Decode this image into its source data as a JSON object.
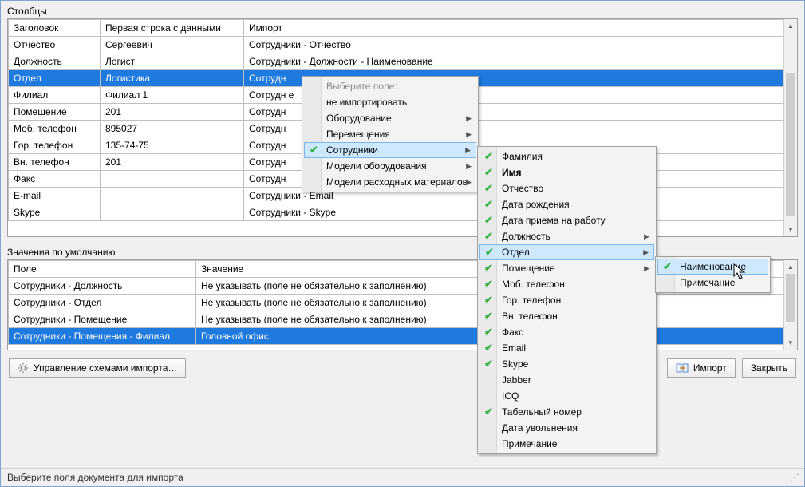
{
  "labels": {
    "columns_section": "Столбцы",
    "defaults_section": "Значения по умолчанию",
    "status": "Выберите поля документа для импорта"
  },
  "columns_table": {
    "headers": {
      "c0": "Заголовок",
      "c1": "Первая строка с данными",
      "c2": "Импорт"
    },
    "rows": [
      {
        "c0": "Отчество",
        "c1": "Сергеевич",
        "c2": "Сотрудники - Отчество"
      },
      {
        "c0": "Должность",
        "c1": "Логист",
        "c2": "Сотрудники - Должности - Наименование"
      },
      {
        "c0": "Отдел",
        "c1": "Логистика",
        "c2": "Сотрудн",
        "selected": true
      },
      {
        "c0": "Филиал",
        "c1": "Филиал 1",
        "c2": "Сотрудн                                                   е"
      },
      {
        "c0": "Помещение",
        "c1": "201",
        "c2": "Сотрудн"
      },
      {
        "c0": "Моб. телефон",
        "c1": "895027",
        "c2": "Сотрудн"
      },
      {
        "c0": "Гор. телефон",
        "c1": "135-74-75",
        "c2": "Сотрудн"
      },
      {
        "c0": "Вн. телефон",
        "c1": "201",
        "c2": "Сотрудн"
      },
      {
        "c0": "Факс",
        "c1": "",
        "c2": "Сотрудн"
      },
      {
        "c0": "E-mail",
        "c1": "",
        "c2": "Сотрудники - Email"
      },
      {
        "c0": "Skype",
        "c1": "",
        "c2": "Сотрудники - Skype"
      }
    ]
  },
  "defaults_table": {
    "headers": {
      "c0": "Поле",
      "c1": "Значение"
    },
    "rows": [
      {
        "c0": "Сотрудники - Должность",
        "c1": "Не указывать (поле не обязательно к заполнению)"
      },
      {
        "c0": "Сотрудники - Отдел",
        "c1": "Не указывать (поле не обязательно к заполнению)"
      },
      {
        "c0": "Сотрудники - Помещение",
        "c1": "Не указывать (поле не обязательно к заполнению)"
      },
      {
        "c0": "Сотрудники - Помещения - Филиал",
        "c1": "Головной офис",
        "selected": true
      }
    ]
  },
  "buttons": {
    "manage_schemas": "Управление схемами импорта…",
    "import": "Импорт",
    "close": "Закрыть"
  },
  "menu1": {
    "header": "Выберите поле:",
    "items": [
      {
        "label": "не импортировать"
      },
      {
        "label": "Оборудование",
        "sub": true
      },
      {
        "label": "Перемещения",
        "sub": true
      },
      {
        "label": "Сотрудники",
        "sub": true,
        "check": true,
        "hovered": true
      },
      {
        "label": "Модели оборудования",
        "sub": true
      },
      {
        "label": "Модели расходных материалов",
        "sub": true
      }
    ]
  },
  "menu2": {
    "items": [
      {
        "label": "Фамилия",
        "check": true
      },
      {
        "label": "Имя",
        "check": true,
        "bold": true
      },
      {
        "label": "Отчество",
        "check": true
      },
      {
        "label": "Дата рождения",
        "check": true
      },
      {
        "label": "Дата приема на работу",
        "check": true
      },
      {
        "label": "Должность",
        "check": true,
        "sub": true
      },
      {
        "label": "Отдел",
        "check": true,
        "sub": true,
        "hovered": true
      },
      {
        "label": "Помещение",
        "check": true,
        "sub": true
      },
      {
        "label": "Моб. телефон",
        "check": true
      },
      {
        "label": "Гор. телефон",
        "check": true
      },
      {
        "label": "Вн. телефон",
        "check": true
      },
      {
        "label": "Факс",
        "check": true
      },
      {
        "label": "Email",
        "check": true
      },
      {
        "label": "Skype",
        "check": true
      },
      {
        "label": "Jabber"
      },
      {
        "label": "ICQ"
      },
      {
        "label": "Табельный номер",
        "check": true
      },
      {
        "label": "Дата увольнения"
      },
      {
        "label": "Примечание"
      }
    ]
  },
  "menu3": {
    "items": [
      {
        "label": "Наименование",
        "check": true,
        "hovered": true
      },
      {
        "label": "Примечание"
      }
    ]
  }
}
